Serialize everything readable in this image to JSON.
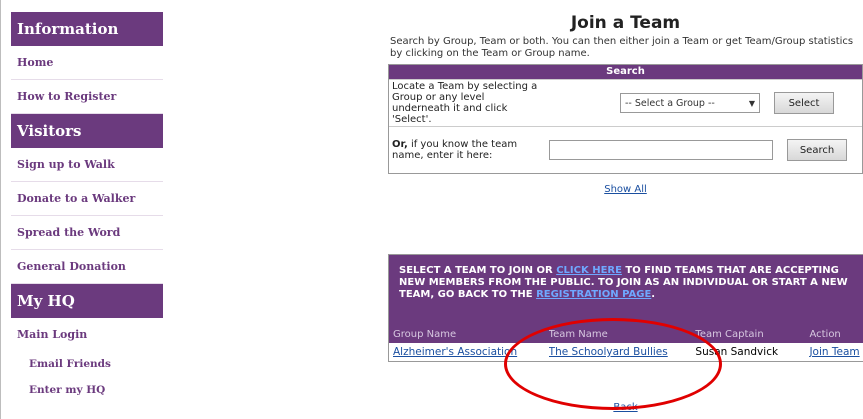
{
  "sidebar": {
    "sections": [
      {
        "title": "Information",
        "items": [
          "Home",
          "How to Register"
        ]
      },
      {
        "title": "Visitors",
        "items": [
          "Sign up to Walk",
          "Donate to a Walker",
          "Spread the Word",
          "General Donation"
        ]
      },
      {
        "title": "My HQ",
        "items": [
          "Main Login"
        ],
        "subitems": [
          "Email Friends",
          "Enter my HQ"
        ]
      }
    ]
  },
  "main": {
    "title": "Join a Team",
    "intro": "Search by Group, Team or both. You can then either join a Team or get Team/Group statistics by clicking on the Team or Group name.",
    "search": {
      "header": "Search",
      "group_label": "Locate a Team by selecting a Group or any level underneath it and click 'Select'.",
      "group_select_value": "-- Select a Group --",
      "select_button": "Select",
      "name_label_bold": "Or,",
      "name_label_rest": " if you know the team name, enter it here:",
      "name_input_value": "",
      "search_button": "Search"
    },
    "show_all": "Show All",
    "team_table": {
      "header_text_1": "SELECT A TEAM TO JOIN OR ",
      "header_link_1": "CLICK HERE",
      "header_text_2": " TO FIND TEAMS THAT ARE ACCEPTING NEW MEMBERS FROM THE PUBLIC. TO JOIN AS AN INDIVIDUAL OR START A NEW TEAM, GO BACK TO THE ",
      "header_link_2": "REGISTRATION PAGE",
      "header_text_3": ".",
      "columns": [
        "Group Name",
        "Team Name",
        "Team Captain",
        "Action"
      ],
      "rows": [
        {
          "group": "Alzheimer's Association",
          "team": "The Schoolyard Bullies",
          "captain": "Susan Sandvick",
          "action": "Join Team"
        }
      ]
    },
    "back": "Back"
  },
  "colors": {
    "brand_purple": "#6b3a7e",
    "link_blue": "#1a4fa0",
    "highlight_red": "#e00000"
  }
}
